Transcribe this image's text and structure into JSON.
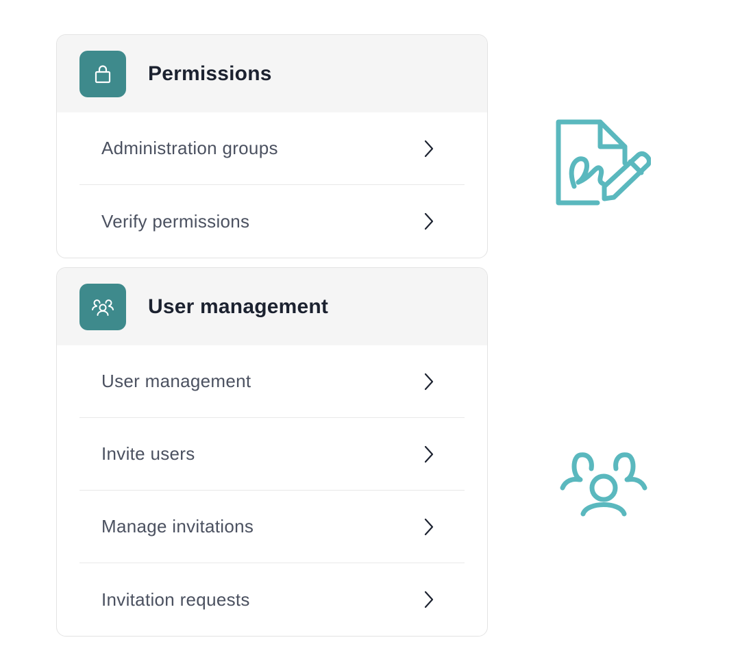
{
  "sections": [
    {
      "title": "Permissions",
      "icon": "lock-icon",
      "items": [
        {
          "label": "Administration groups"
        },
        {
          "label": "Verify permissions"
        }
      ]
    },
    {
      "title": "User management",
      "icon": "users-icon",
      "items": [
        {
          "label": "User management"
        },
        {
          "label": "Invite users"
        },
        {
          "label": "Manage invitations"
        },
        {
          "label": "Invitation requests"
        }
      ]
    }
  ],
  "illustrations": {
    "top": "contract-signature-icon",
    "bottom": "user-group-icon"
  },
  "colors": {
    "accent": "#3e8a8c",
    "illustration": "#5ab8be",
    "header_bg": "#f5f5f5",
    "title_text": "#1c2230",
    "item_text": "#4b5160"
  }
}
